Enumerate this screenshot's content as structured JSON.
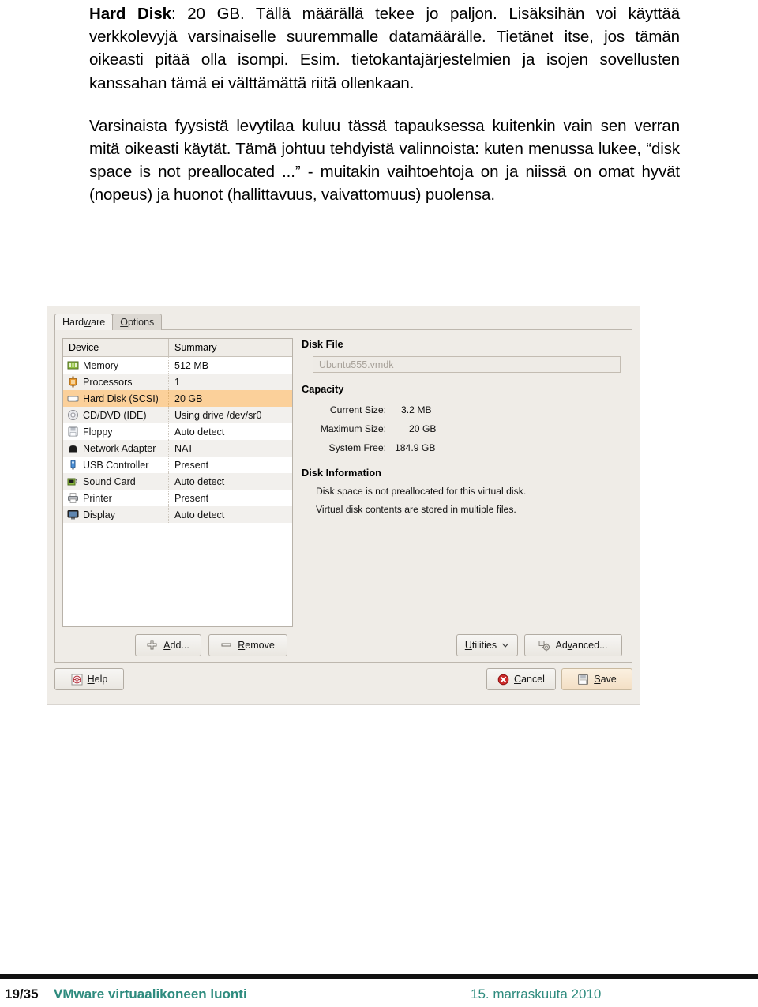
{
  "slide": {
    "paragraphs": [
      {
        "id": "p1",
        "lead_bold": "Hard Disk",
        "text": ": 20 GB. Tällä määrällä tekee jo paljon. Lisäksihän voi käyttää verkkolevyjä varsinaiselle suuremmalle datamäärälle. Tietänet itse, jos tämän oikeasti pitää olla isompi. Esim. tietokantajärjestelmien ja isojen sovellusten kanssahan tämä ei välttämättä riitä ollenkaan."
      },
      {
        "id": "p2",
        "lead_bold": "",
        "text": "Varsinaista fyysistä levytilaa kuluu tässä tapauksessa kuitenkin vain sen verran mitä oikeasti käytät. Tämä johtuu tehdyistä valinnoista: kuten menussa lukee, “disk space is not preallocated ...” - muitakin vaihtoehtoja on ja niissä on omat hyvät (nopeus) ja huonot (hallittavuus, vaivattomuus) puolensa."
      }
    ]
  },
  "dialog": {
    "tabs": [
      {
        "label": "Hardware",
        "mnemonic": "w",
        "active": true
      },
      {
        "label": "Options",
        "mnemonic": "O",
        "active": false
      }
    ],
    "device_table": {
      "columns": [
        "Device",
        "Summary"
      ],
      "rows": [
        {
          "icon": "memory-icon",
          "device": "Memory",
          "summary": "512 MB",
          "selected": false
        },
        {
          "icon": "processor-icon",
          "device": "Processors",
          "summary": "1",
          "selected": false
        },
        {
          "icon": "hard-disk-icon",
          "device": "Hard Disk (SCSI)",
          "summary": "20 GB",
          "selected": true
        },
        {
          "icon": "cd-dvd-icon",
          "device": "CD/DVD (IDE)",
          "summary": "Using drive /dev/sr0",
          "selected": false
        },
        {
          "icon": "floppy-icon",
          "device": "Floppy",
          "summary": "Auto detect",
          "selected": false
        },
        {
          "icon": "network-adapter-icon",
          "device": "Network Adapter",
          "summary": "NAT",
          "selected": false
        },
        {
          "icon": "usb-controller-icon",
          "device": "USB Controller",
          "summary": "Present",
          "selected": false
        },
        {
          "icon": "sound-card-icon",
          "device": "Sound Card",
          "summary": "Auto detect",
          "selected": false
        },
        {
          "icon": "printer-icon",
          "device": "Printer",
          "summary": "Present",
          "selected": false
        },
        {
          "icon": "display-icon",
          "device": "Display",
          "summary": "Auto detect",
          "selected": false
        }
      ]
    },
    "detail": {
      "disk_file": {
        "title": "Disk File",
        "value": "Ubuntu555.vmdk"
      },
      "capacity": {
        "title": "Capacity",
        "rows": [
          {
            "label": "Current Size:",
            "value": "3.2 MB"
          },
          {
            "label": "Maximum Size:",
            "value": "20 GB"
          },
          {
            "label": "System Free:",
            "value": "184.9 GB"
          }
        ]
      },
      "disk_information": {
        "title": "Disk Information",
        "lines": [
          "Disk space is not preallocated for this virtual disk.",
          "Virtual disk contents are stored in multiple files."
        ]
      }
    },
    "buttons": {
      "add": {
        "label": "Add...",
        "pre": "",
        "mn": "A",
        "post": "dd..."
      },
      "remove": {
        "label": "Remove",
        "pre": "",
        "mn": "R",
        "post": "emove"
      },
      "utilities": {
        "label": "Utilities",
        "pre": "",
        "mn": "U",
        "post": "tilities"
      },
      "advanced": {
        "label": "Advanced...",
        "pre": "Ad",
        "mn": "v",
        "post": "anced..."
      },
      "help": {
        "label": "Help",
        "pre": "",
        "mn": "H",
        "post": "elp"
      },
      "cancel": {
        "label": "Cancel",
        "pre": "",
        "mn": "C",
        "post": "ancel"
      },
      "save": {
        "label": "Save",
        "pre": "",
        "mn": "S",
        "post": "ave"
      }
    }
  },
  "footer": {
    "page": "19/35",
    "title": "VMware virtuaalikoneen luonti",
    "date": "15. marraskuuta 2010",
    "accent_color": "#2e8b7e"
  },
  "colors": {
    "selected_row": "#fbd09a",
    "dialog_bg": "#efece7",
    "default_button": "#f3dfc4"
  }
}
